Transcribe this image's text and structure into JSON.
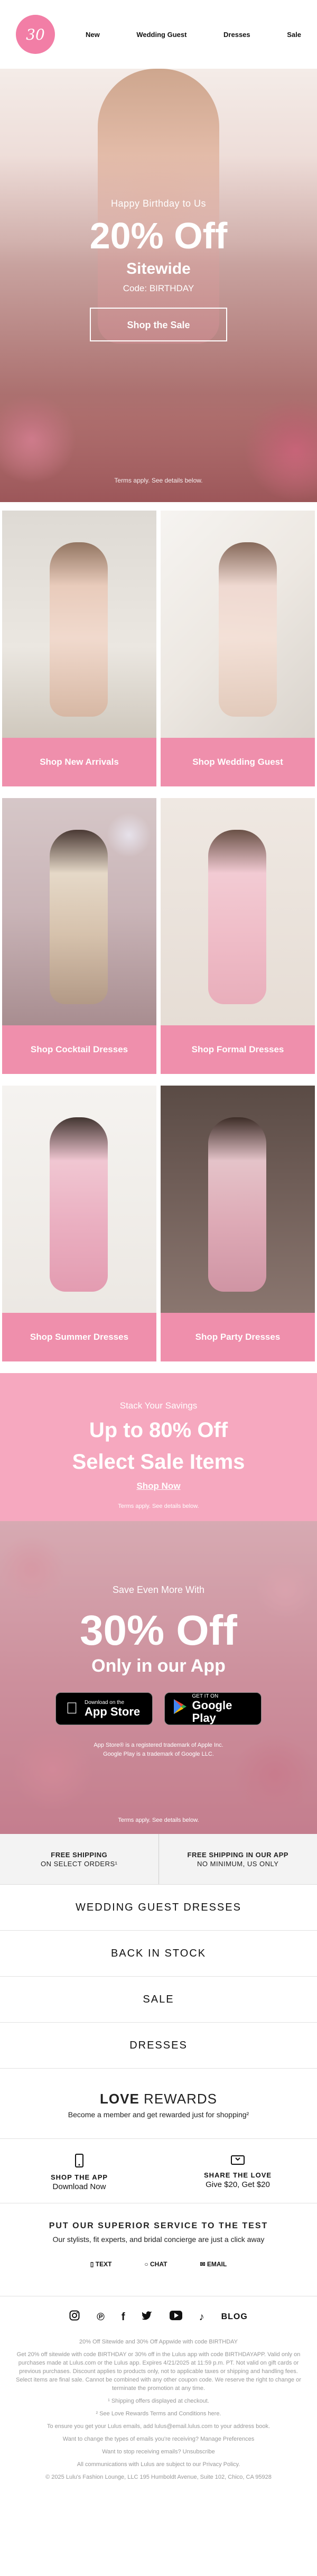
{
  "brand": {
    "logo_text": "30",
    "accent": "#ef8fac"
  },
  "nav": {
    "items": [
      "New",
      "Wedding Guest",
      "Dresses",
      "Sale"
    ]
  },
  "hero": {
    "kicker": "Happy Birthday to Us",
    "headline": "20% Off",
    "subhead": "Sitewide",
    "code": "Code: BIRTHDAY",
    "button": "Shop the Sale",
    "fine": "Terms apply. See details below."
  },
  "categories": [
    {
      "label": "Shop New Arrivals"
    },
    {
      "label": "Shop Wedding Guest"
    },
    {
      "label": "Shop Cocktail Dresses"
    },
    {
      "label": "Shop Formal Dresses"
    },
    {
      "label": "Shop Summer Dresses"
    },
    {
      "label": "Shop Party Dresses"
    }
  ],
  "sale": {
    "kicker": "Stack Your Savings",
    "line1": "Up to 80% Off",
    "line2": "Select Sale Items",
    "link": "Shop Now",
    "fine": "Terms apply. See details below."
  },
  "app": {
    "kicker": "Save Even More With",
    "headline": "30% Off",
    "subhead": "Only in our App",
    "app_store_small": "Download on the",
    "app_store_big": "App Store",
    "play_small": "GET IT ON",
    "play_big": "Google Play",
    "legal1": "App Store® is a registered trademark of Apple Inc.",
    "legal2": "Google Play is a trademark of Google LLC.",
    "fine": "Terms apply. See details below."
  },
  "shipping": {
    "left_title": "FREE SHIPPING",
    "left_sub": "ON SELECT ORDERS¹",
    "right_title": "FREE SHIPPING IN OUR APP",
    "right_sub": "NO MINIMUM, US ONLY"
  },
  "links": [
    "WEDDING GUEST DRESSES",
    "BACK IN STOCK",
    "SALE",
    "DRESSES"
  ],
  "rewards": {
    "title_bold": "LOVE",
    "title_thin": "REWARDS",
    "sub": "Become a member and get rewarded just for shopping²"
  },
  "share": {
    "left_title": "SHOP THE APP",
    "left_sub": "Download Now",
    "right_title": "SHARE THE LOVE",
    "right_sub": "Give $20, Get $20"
  },
  "service": {
    "title": "PUT OUR SUPERIOR SERVICE TO THE TEST",
    "sub": "Our stylists, fit experts, and bridal concierge are just a click away",
    "text": "TEXT",
    "chat": "CHAT",
    "email": "EMAIL"
  },
  "social": {
    "blog": "BLOG"
  },
  "footer": {
    "p1": "20% Off Sitewide and 30% Off Appwide with code BIRTHDAY",
    "p2": "Get 20% off sitewide with code BIRTHDAY or 30% off in the Lulus app with code BIRTHDAYAPP. Valid only on purchases made at Lulus.com or the Lulus app. Expires 4/21/2025 at 11:59 p.m. PT. Not valid on gift cards or previous purchases. Discount applies to products only, not to applicable taxes or shipping and handling fees. Select items are final sale. Cannot be combined with any other coupon code. We reserve the right to change or terminate the promotion at any time.",
    "p3": "¹ Shipping offers displayed at checkout.",
    "p4": "² See Love Rewards Terms and Conditions here.",
    "p5": "To ensure you get your Lulus emails, add lulus@email.lulus.com to your address book.",
    "p6": "Want to change the types of emails you're receiving? Manage Preferences",
    "p7": "Want to stop receiving emails? Unsubscribe",
    "p8": "All communications with Lulus are subject to our Privacy Policy.",
    "p9": "© 2025 Lulu's Fashion Lounge, LLC 195 Humboldt Avenue, Suite 102, Chico, CA 95928"
  }
}
